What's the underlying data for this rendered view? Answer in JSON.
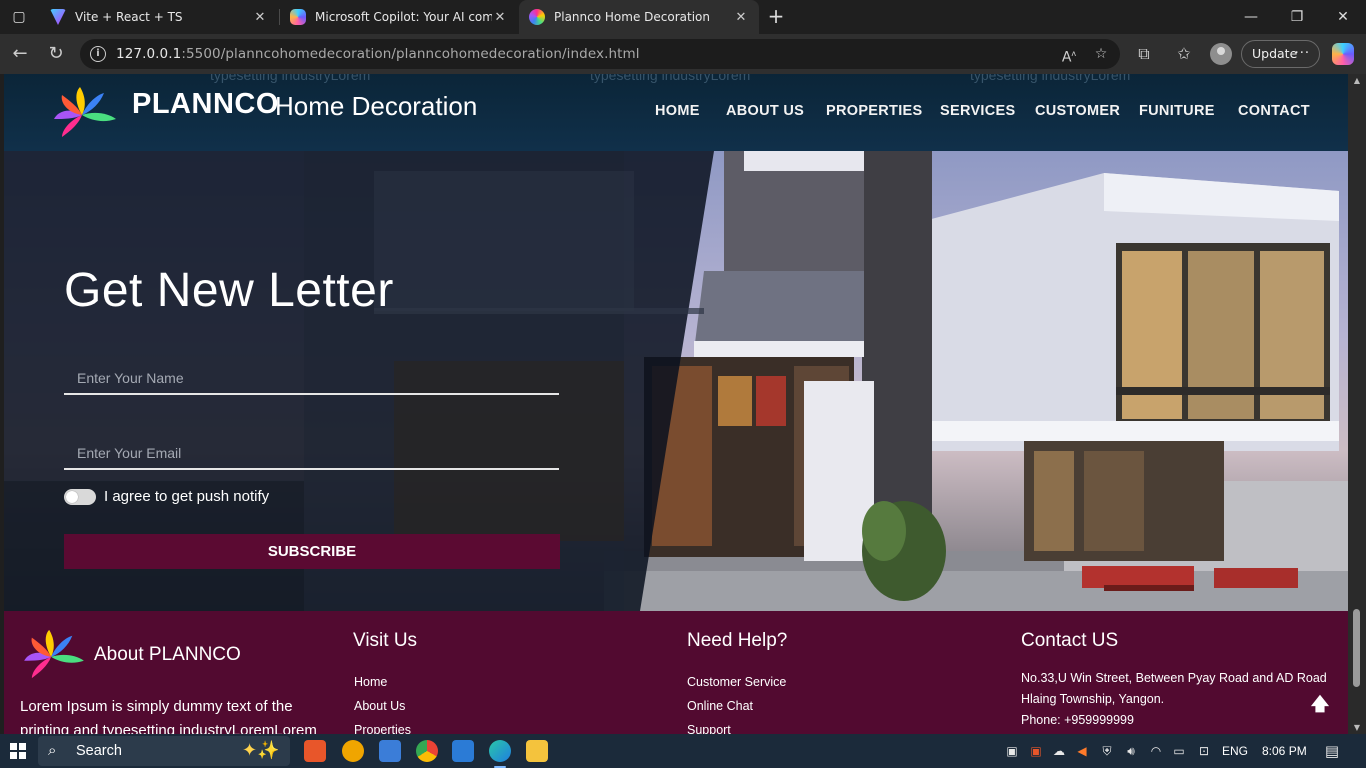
{
  "browser": {
    "tabs": [
      {
        "label": "Vite + React + TS",
        "color": "#a855f7"
      },
      {
        "label": "Microsoft Copilot: Your AI compa",
        "color": "#3b82f6"
      },
      {
        "label": "Plannco Home Decoration",
        "color": "#22c55e"
      }
    ],
    "url_host": "127.0.0.1",
    "url_rest": ":5500/planncohomedecoration/planncohomedecoration/index.html",
    "update_label": "Update"
  },
  "header": {
    "ghost_texts": [
      "typesetting industryLorem",
      "typesetting industryLorem",
      "typesetting industryLorem"
    ],
    "brand": "PLANNCO",
    "brand_sub": "Home Decoration",
    "nav": [
      "HOME",
      "ABOUT US",
      "PROPERTIES",
      "SERVICES",
      "CUSTOMER",
      "FUNITURE",
      "CONTACT"
    ]
  },
  "hero": {
    "title": "Get New Letter",
    "name_placeholder": "Enter Your Name",
    "email_placeholder": "Enter Your Email",
    "agree_label": "I agree to get push notify",
    "subscribe_label": "SUBSCRIBE"
  },
  "footer": {
    "about_title": "About PLANNCO",
    "about_text": "Lorem Ipsum is simply dummy text of the printing and typesetting industryLoremLorem",
    "visit_title": "Visit Us",
    "visit_links": [
      "Home",
      "About Us",
      "Properties"
    ],
    "help_title": "Need Help?",
    "help_links": [
      "Customer Service",
      "Online Chat",
      "Support"
    ],
    "contact_title": "Contact US",
    "contact_lines": [
      "No.33,U Win Street, Between Pyay Road and AD Road",
      "Hlaing Township, Yangon.",
      "Phone: +959999999"
    ]
  },
  "taskbar": {
    "search_label": "Search",
    "lang": "ENG",
    "time": "8:06 PM"
  },
  "colors": {
    "accent": "#5b0a32",
    "footer_bg": "#520a30",
    "header_bg": "#0b2538"
  }
}
